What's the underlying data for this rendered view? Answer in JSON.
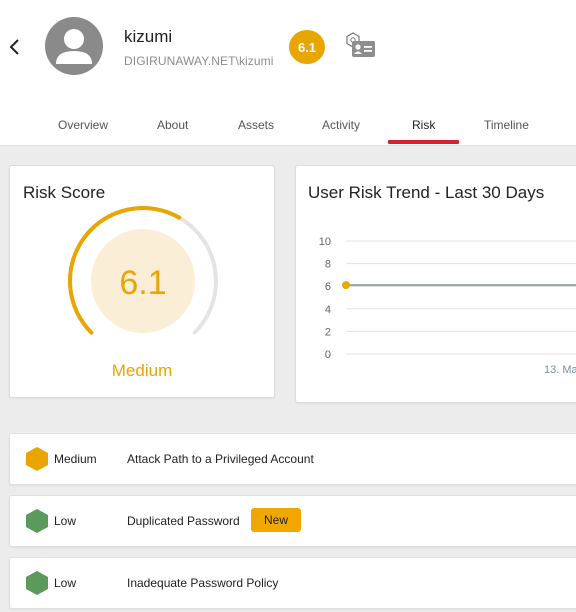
{
  "user": {
    "name": "kizumi",
    "domain_account": "DIGIRUNAWAY.NET\\kizumi",
    "risk_score": "6.1"
  },
  "tabs": [
    {
      "label": "Overview"
    },
    {
      "label": "About"
    },
    {
      "label": "Assets"
    },
    {
      "label": "Activity"
    },
    {
      "label": "Risk",
      "active": true
    },
    {
      "label": "Timeline"
    }
  ],
  "risk_score_card": {
    "title": "Risk Score",
    "score": "6.1",
    "score_value": 6.1,
    "score_max": 10,
    "level": "Medium"
  },
  "trend_card": {
    "title": "User Risk Trend - Last 30 Days",
    "chart_data": {
      "type": "line",
      "title": "User Risk Trend - Last 30 Days",
      "y_ticks": [
        "10",
        "8",
        "6",
        "4",
        "2",
        "0"
      ],
      "ylim": [
        0,
        10
      ],
      "x_visible_label": "13. Ma",
      "series": [
        {
          "values": [
            6.1,
            6.1
          ]
        }
      ],
      "grid": true,
      "line_color": "#9aa3ad",
      "point_color": "#e9a500"
    }
  },
  "risks": [
    {
      "severity": "Medium",
      "title": "Attack Path to a Privileged Account",
      "color": "#e9a500",
      "badge": ""
    },
    {
      "severity": "Low",
      "title": "Duplicated Password",
      "color": "#5a9a5c",
      "badge": "New"
    },
    {
      "severity": "Low",
      "title": "Inadequate Password Policy",
      "color": "#5a9a5c",
      "badge": ""
    }
  ],
  "colors": {
    "accent_red": "#d1242f",
    "medium": "#e9a500",
    "low": "#5a9a5c"
  },
  "icons": {
    "back": "chevron-left-icon",
    "avatar": "user-avatar-icon",
    "identity": "id-card-icon"
  }
}
